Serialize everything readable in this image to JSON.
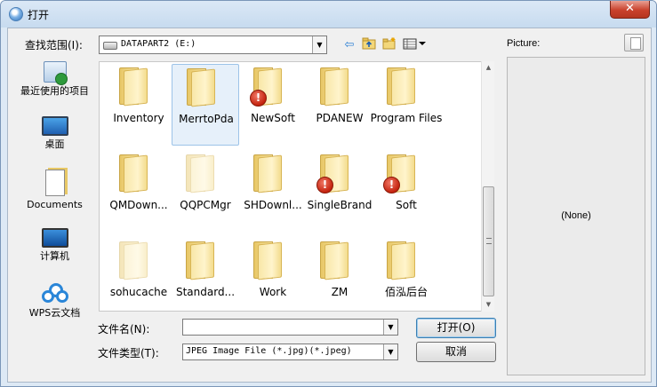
{
  "window": {
    "title": "打开",
    "close_glyph": "✕"
  },
  "lookin": {
    "label": "查找范围(I):",
    "value": "DATAPART2 (E:)"
  },
  "toolbar": {
    "back_icon": "back-arrow-icon",
    "up_icon": "up-folder-icon",
    "new_folder_icon": "new-folder-icon",
    "view_menu_icon": "view-menu-icon"
  },
  "places": [
    {
      "label": "最近使用的项目",
      "icon": "recent-items-icon"
    },
    {
      "label": "桌面",
      "icon": "desktop-icon"
    },
    {
      "label": "Documents",
      "icon": "documents-icon"
    },
    {
      "label": "计算机",
      "icon": "computer-icon"
    },
    {
      "label": "WPS云文档",
      "icon": "wps-cloud-icon"
    }
  ],
  "files": [
    {
      "name": "Inventory",
      "warning": false,
      "faded": false,
      "selected": false
    },
    {
      "name": "MerrtoPda",
      "warning": false,
      "faded": false,
      "selected": true
    },
    {
      "name": "NewSoft",
      "warning": true,
      "faded": false,
      "selected": false
    },
    {
      "name": "PDANEW",
      "warning": false,
      "faded": false,
      "selected": false
    },
    {
      "name": "Program Files",
      "warning": false,
      "faded": false,
      "selected": false
    },
    {
      "name": "QMDown...",
      "warning": false,
      "faded": false,
      "selected": false
    },
    {
      "name": "QQPCMgr",
      "warning": false,
      "faded": true,
      "selected": false
    },
    {
      "name": "SHDownl...",
      "warning": false,
      "faded": false,
      "selected": false
    },
    {
      "name": "SingleBrand",
      "warning": true,
      "faded": false,
      "selected": false
    },
    {
      "name": "Soft",
      "warning": true,
      "faded": false,
      "selected": false
    },
    {
      "name": "sohucache",
      "warning": false,
      "faded": true,
      "selected": false
    },
    {
      "name": "Standard...",
      "warning": false,
      "faded": false,
      "selected": false
    },
    {
      "name": "Work",
      "warning": false,
      "faded": false,
      "selected": false
    },
    {
      "name": "ZM",
      "warning": false,
      "faded": false,
      "selected": false
    },
    {
      "name": "佰泓后台",
      "warning": false,
      "faded": false,
      "selected": false
    }
  ],
  "filename": {
    "label": "文件名(N):",
    "value": ""
  },
  "filetype": {
    "label": "文件类型(T):",
    "value": "JPEG Image File (*.jpg)(*.jpeg)"
  },
  "buttons": {
    "open": "打开(O)",
    "cancel": "取消"
  },
  "preview": {
    "label": "Picture:",
    "none_text": "(None)"
  }
}
